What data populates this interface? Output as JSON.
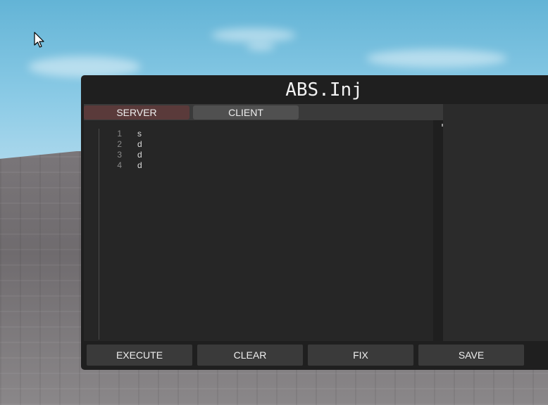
{
  "window": {
    "title": "ABS.Inj"
  },
  "tabs": [
    {
      "label": "SERVER"
    },
    {
      "label": "CLIENT"
    }
  ],
  "editor": {
    "lines": [
      {
        "number": "1",
        "text": "s"
      },
      {
        "number": "2",
        "text": "d"
      },
      {
        "number": "3",
        "text": "d"
      },
      {
        "number": "4",
        "text": "d"
      }
    ]
  },
  "buttons": {
    "execute": "EXECUTE",
    "clear": "CLEAR",
    "fix": "FIX",
    "save": "SAVE"
  },
  "colors": {
    "window_bg": "#1f1f1f",
    "active_tab": "#5a3a3a",
    "inactive_tab": "#505050",
    "button_bg": "#3a3a3a"
  }
}
